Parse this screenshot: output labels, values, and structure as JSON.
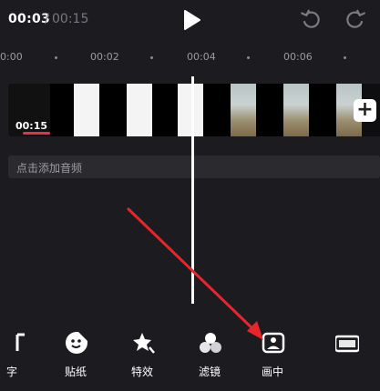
{
  "header": {
    "current_time": "00:03",
    "separator": "/",
    "total_time": "00:15",
    "play_icon": "play-icon",
    "undo_icon": "undo-icon",
    "redo_icon": "redo-icon"
  },
  "ruler": {
    "labels": [
      "0:00",
      "00:02",
      "00:04",
      "00:06"
    ]
  },
  "track": {
    "duration_label": "00:15",
    "add_label": "+"
  },
  "audio": {
    "placeholder": "点击添加音频"
  },
  "tools": [
    {
      "label": "字",
      "icon": "text-icon"
    },
    {
      "label": "贴纸",
      "icon": "sticker-icon"
    },
    {
      "label": "特效",
      "icon": "effects-icon"
    },
    {
      "label": "滤镜",
      "icon": "filter-icon"
    },
    {
      "label": "画中",
      "icon": "picture-in-picture-icon"
    },
    {
      "label": "",
      "icon": "ratio-icon"
    }
  ],
  "colors": {
    "background": "#1c1c20",
    "annotation_arrow": "#e8262a",
    "track_marker": "#e83048"
  }
}
